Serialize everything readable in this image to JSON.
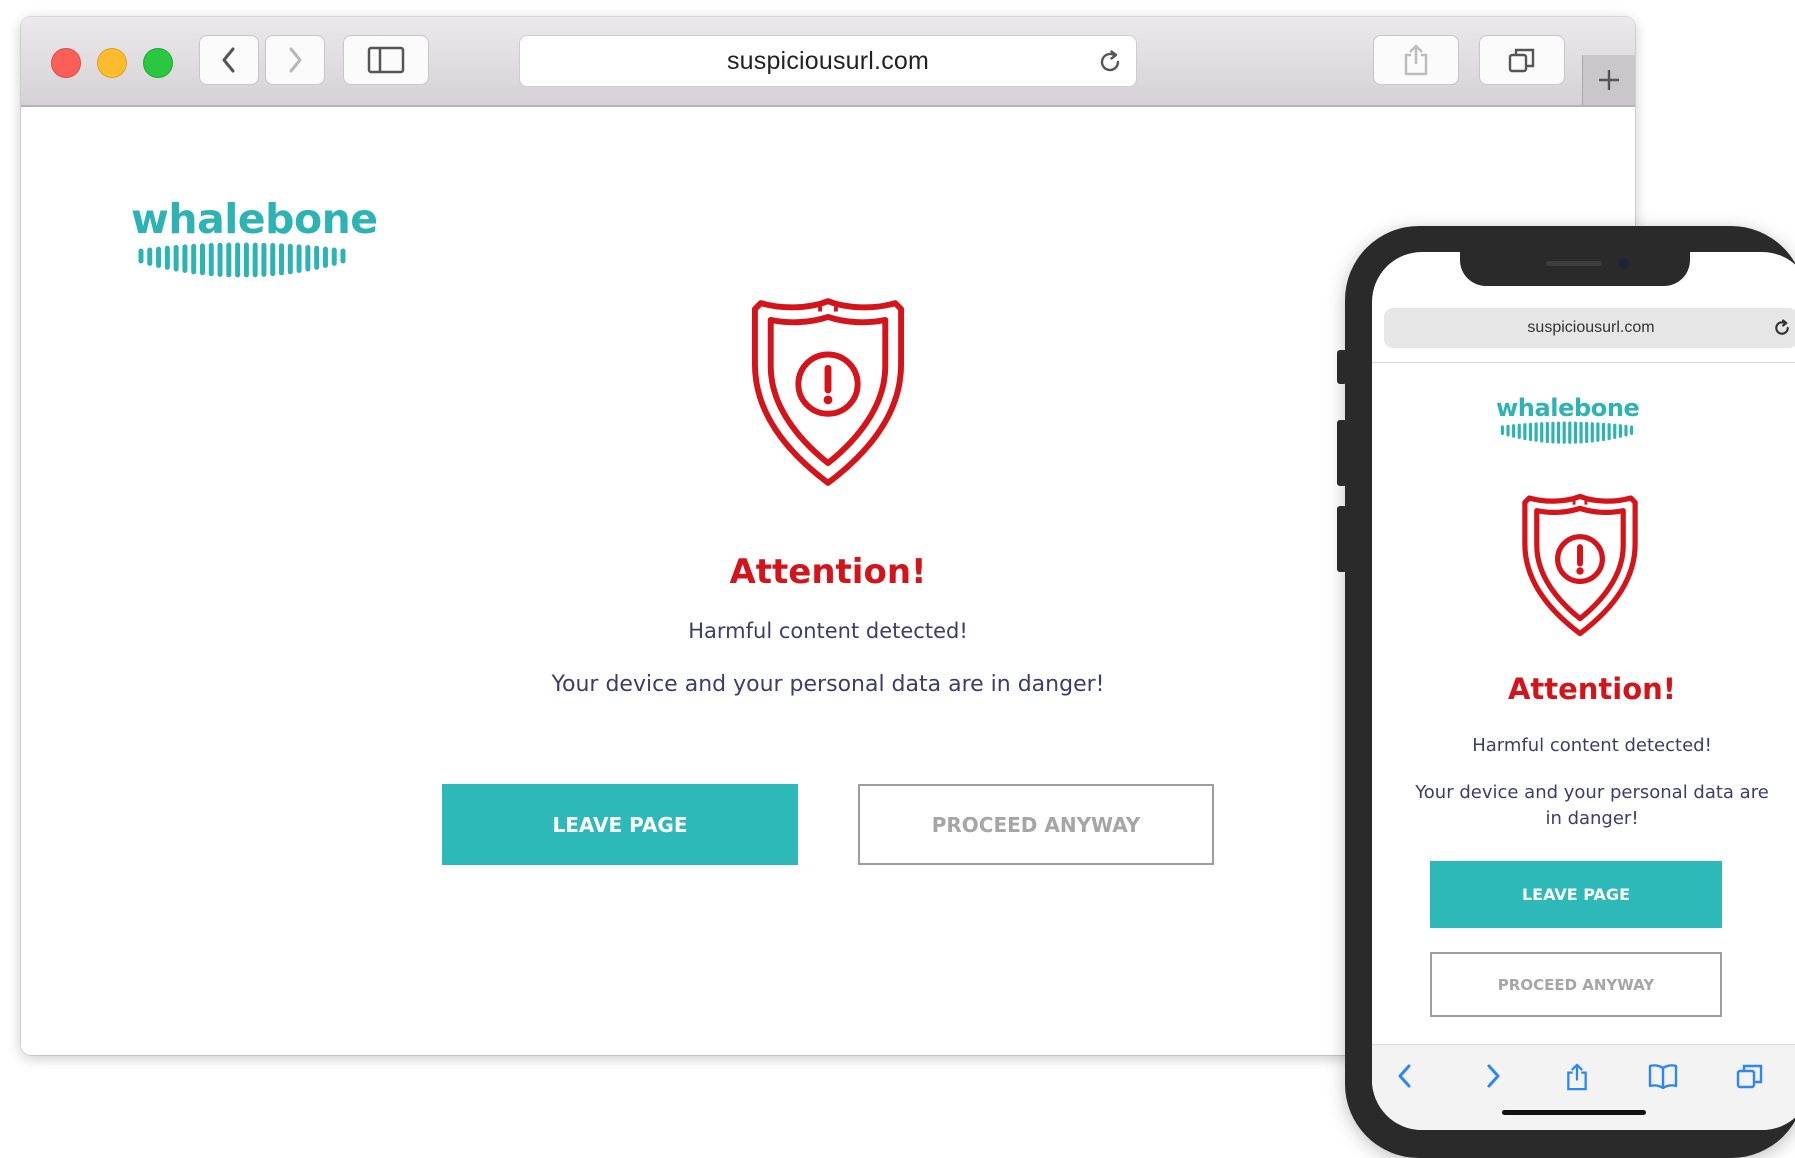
{
  "desktop": {
    "url": "suspiciousurl.com",
    "logo_text": "whalebone",
    "title": "Attention!",
    "line1": "Harmful content detected!",
    "line2": "Your device and your personal data are in danger!",
    "leave_label": "LEAVE PAGE",
    "proceed_label": "PROCEED ANYWAY"
  },
  "mobile": {
    "url": "suspiciousurl.com",
    "logo_text": "whalebone",
    "title": "Attention!",
    "line1": "Harmful content detected!",
    "line2": "Your device and your personal data are in danger!",
    "leave_label": "LEAVE PAGE",
    "proceed_label": "PROCEED ANYWAY"
  },
  "colors": {
    "brand_teal": "#2eb9b9",
    "alert_red": "#d4141b",
    "text_navy": "#3d3d6b",
    "ios_blue": "#2c86f5"
  },
  "icons": {
    "toolbar": [
      "back-icon",
      "forward-icon",
      "sidebar-icon",
      "reload-icon",
      "share-icon",
      "tabs-icon",
      "new-tab-icon"
    ],
    "mobile_toolbar": [
      "back-icon",
      "forward-icon",
      "share-icon",
      "bookmarks-icon",
      "tabs-icon"
    ],
    "alert": "shield-alert-icon"
  }
}
